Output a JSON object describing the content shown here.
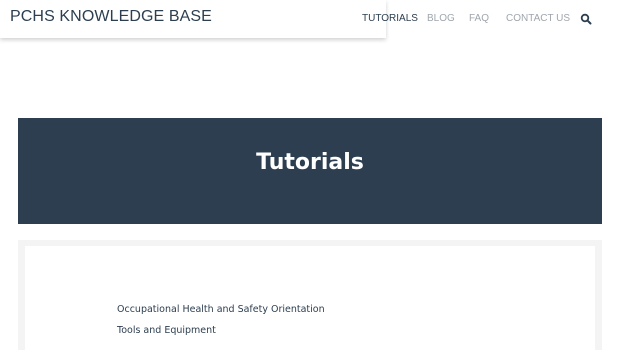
{
  "header": {
    "site_title": "PCHS KNOWLEDGE BASE",
    "nav": [
      {
        "label": "TUTORIALS",
        "active": true
      },
      {
        "label": "BLOG",
        "active": false
      },
      {
        "label": "FAQ",
        "active": false
      },
      {
        "label": "CONTACT US",
        "active": false
      }
    ],
    "search_icon": "search-icon"
  },
  "hero": {
    "title": "Tutorials",
    "background": "#2d3e50"
  },
  "tutorials": [
    {
      "label": "Occupational Health and Safety Orientation"
    },
    {
      "label": "Tools and Equipment"
    }
  ],
  "colors": {
    "accent": "#2c3e50",
    "nav_inactive": "#9fa6ad"
  }
}
